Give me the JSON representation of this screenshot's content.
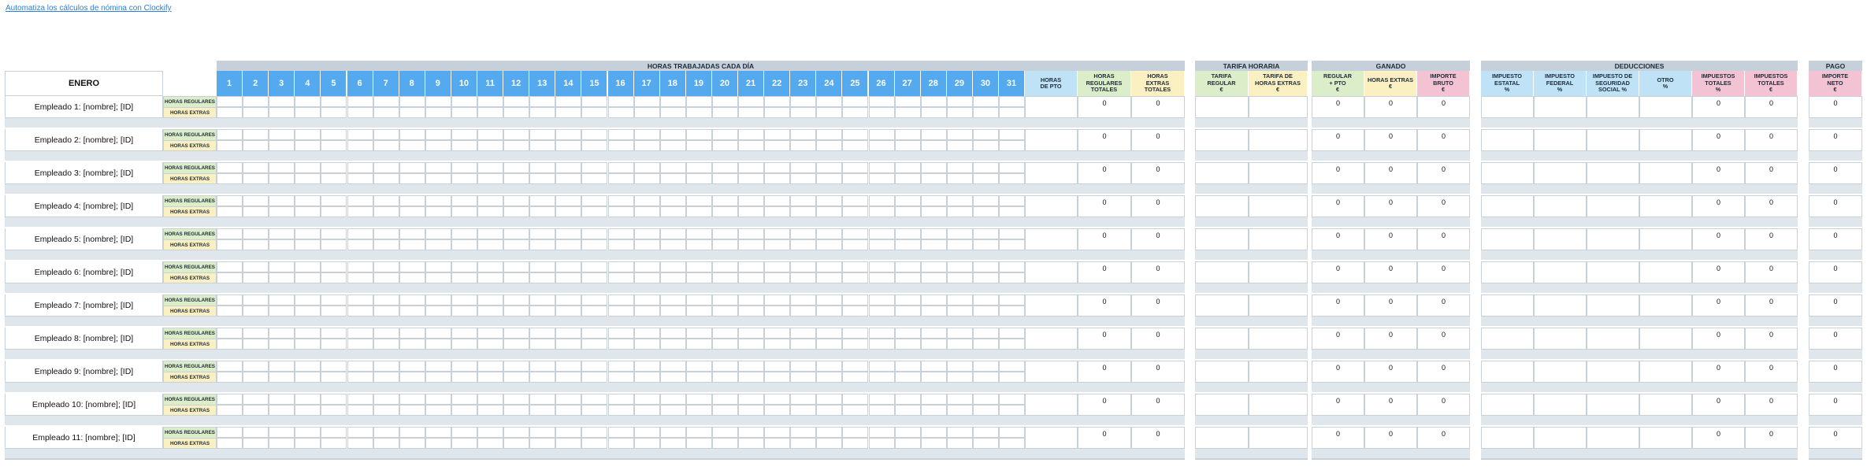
{
  "link_text": "Automatiza los cálculos de nómina con Clockify",
  "month": "ENERO",
  "row_labels": {
    "regular": "HORAS REGULARES",
    "extra": "HORAS EXTRAS"
  },
  "sections": {
    "hours": "HORAS TRABAJADAS CADA DÍA",
    "rate": "TARIFA HORARIA",
    "earned": "GANADO",
    "deductions": "DEDUCCIONES",
    "pay": "PAGO"
  },
  "days": [
    "1",
    "2",
    "3",
    "4",
    "5",
    "6",
    "7",
    "8",
    "9",
    "10",
    "11",
    "12",
    "13",
    "14",
    "15",
    "16",
    "17",
    "18",
    "19",
    "20",
    "21",
    "22",
    "23",
    "24",
    "25",
    "26",
    "27",
    "28",
    "29",
    "30",
    "31"
  ],
  "headers": {
    "pto": "HORAS\nDE PTO",
    "reg_total": "HORAS\nREGULARES\nTOTALES",
    "ext_total": "HORAS\nEXTRAS\nTOTALES",
    "rate_reg": "TARIFA\nREGULAR\n€",
    "rate_ext": "TARIFA DE\nHORAS EXTRAS\n€",
    "earn_reg": "REGULAR\n+ PTO\n€",
    "earn_ext": "HORAS EXTRAS\n€",
    "earn_gross": "IMPORTE\nBRUTO\n€",
    "tax_state": "IMPUESTO\nESTATAL\n%",
    "tax_fed": "IMPUESTO\nFEDERAL\n%",
    "tax_ss": "IMPUESTO DE\nSEGURIDAD\nSOCIAL %",
    "tax_other": "OTRO\n%",
    "tax_total_pct": "IMPUESTOS\nTOTALES\n%",
    "tax_total": "IMPUESTOS\nTOTALES\n€",
    "net": "IMPORTE\nNETO\n€"
  },
  "employees": [
    {
      "name": "Empleado 1: [nombre]; [ID]",
      "reg_total": "0",
      "ext_total": "0",
      "earn_reg": "0",
      "earn_ext": "0",
      "earn_gross": "0",
      "tax_total_pct": "0",
      "tax_total": "0",
      "net": "0"
    },
    {
      "name": "Empleado 2: [nombre]; [ID]",
      "reg_total": "0",
      "ext_total": "0",
      "earn_reg": "0",
      "earn_ext": "0",
      "earn_gross": "0",
      "tax_total_pct": "0",
      "tax_total": "0",
      "net": "0"
    },
    {
      "name": "Empleado 3: [nombre]; [ID]",
      "reg_total": "0",
      "ext_total": "0",
      "earn_reg": "0",
      "earn_ext": "0",
      "earn_gross": "0",
      "tax_total_pct": "0",
      "tax_total": "0",
      "net": "0"
    },
    {
      "name": "Empleado 4: [nombre]; [ID]",
      "reg_total": "0",
      "ext_total": "0",
      "earn_reg": "0",
      "earn_ext": "0",
      "earn_gross": "0",
      "tax_total_pct": "0",
      "tax_total": "0",
      "net": "0"
    },
    {
      "name": "Empleado 5: [nombre]; [ID]",
      "reg_total": "0",
      "ext_total": "0",
      "earn_reg": "0",
      "earn_ext": "0",
      "earn_gross": "0",
      "tax_total_pct": "0",
      "tax_total": "0",
      "net": "0"
    },
    {
      "name": "Empleado 6: [nombre]; [ID]",
      "reg_total": "0",
      "ext_total": "0",
      "earn_reg": "0",
      "earn_ext": "0",
      "earn_gross": "0",
      "tax_total_pct": "0",
      "tax_total": "0",
      "net": "0"
    },
    {
      "name": "Empleado 7: [nombre]; [ID]",
      "reg_total": "0",
      "ext_total": "0",
      "earn_reg": "0",
      "earn_ext": "0",
      "earn_gross": "0",
      "tax_total_pct": "0",
      "tax_total": "0",
      "net": "0"
    },
    {
      "name": "Empleado 8: [nombre]; [ID]",
      "reg_total": "0",
      "ext_total": "0",
      "earn_reg": "0",
      "earn_ext": "0",
      "earn_gross": "0",
      "tax_total_pct": "0",
      "tax_total": "0",
      "net": "0"
    },
    {
      "name": "Empleado 9: [nombre]; [ID]",
      "reg_total": "0",
      "ext_total": "0",
      "earn_reg": "0",
      "earn_ext": "0",
      "earn_gross": "0",
      "tax_total_pct": "0",
      "tax_total": "0",
      "net": "0"
    },
    {
      "name": "Empleado 10: [nombre]; [ID]",
      "reg_total": "0",
      "ext_total": "0",
      "earn_reg": "0",
      "earn_ext": "0",
      "earn_gross": "0",
      "tax_total_pct": "0",
      "tax_total": "0",
      "net": "0"
    },
    {
      "name": "Empleado 11: [nombre]; [ID]",
      "reg_total": "0",
      "ext_total": "0",
      "earn_reg": "0",
      "earn_ext": "0",
      "earn_gross": "0",
      "tax_total_pct": "0",
      "tax_total": "0",
      "net": "0"
    }
  ]
}
